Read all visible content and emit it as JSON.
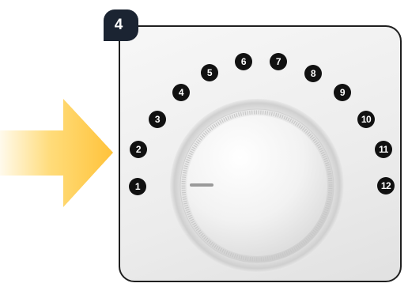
{
  "step_badge": {
    "label": "4"
  },
  "arrow": {
    "icon": "arrow-right-icon",
    "color": "#ffcc40"
  },
  "scale": {
    "numbers": [
      "1",
      "2",
      "3",
      "4",
      "5",
      "6",
      "7",
      "8",
      "9",
      "10",
      "11",
      "12"
    ]
  },
  "knob": {
    "icon": "rotary-dial-knob",
    "marker_color": "#9a9a9a"
  }
}
